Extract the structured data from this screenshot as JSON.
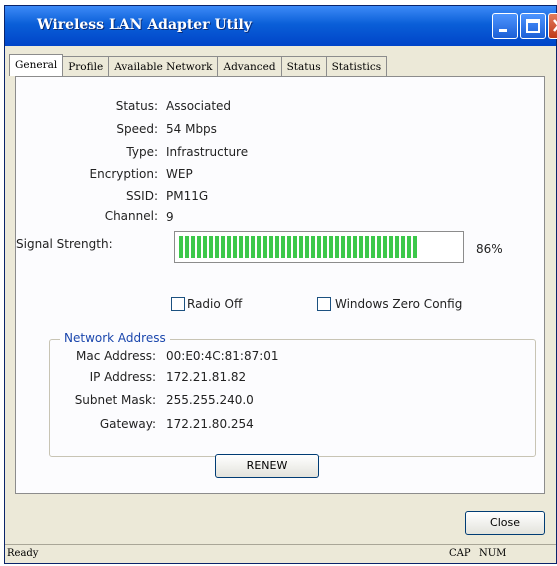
{
  "window": {
    "title": "Wireless LAN Adapter Utily"
  },
  "tabs": [
    {
      "label": "General"
    },
    {
      "label": "Profile"
    },
    {
      "label": "Available Network"
    },
    {
      "label": "Advanced"
    },
    {
      "label": "Status"
    },
    {
      "label": "Statistics"
    }
  ],
  "general": {
    "status_label": "Status:",
    "status_value": "Associated",
    "speed_label": "Speed:",
    "speed_value": "54 Mbps",
    "type_label": "Type:",
    "type_value": "Infrastructure",
    "encryption_label": "Encryption:",
    "encryption_value": "WEP",
    "ssid_label": "SSID:",
    "ssid_value": "PM11G",
    "channel_label": "Channel:",
    "channel_value": "9",
    "signal_label": "Signal Strength:",
    "signal_value": "86%",
    "signal_fraction": 0.86,
    "radio_off_label": "Radio Off",
    "radio_off_checked": false,
    "wzc_label": "Windows Zero Config",
    "wzc_checked": false
  },
  "network": {
    "group_title": "Network Address",
    "mac_label": "Mac Address:",
    "mac_value": "00:E0:4C:81:87:01",
    "ip_label": "IP Address:",
    "ip_value": "172.21.81.82",
    "subnet_label": "Subnet Mask:",
    "subnet_value": "255.255.240.0",
    "gateway_label": "Gateway:",
    "gateway_value": "172.21.80.254"
  },
  "buttons": {
    "renew": "RENEW",
    "close": "Close"
  },
  "statusbar": {
    "status": "Ready",
    "caps": "CAP",
    "num": "NUM"
  },
  "colors": {
    "signal": "#3cc84a",
    "title_bar": "#0a5fd8",
    "group_title": "#1b47ad"
  }
}
